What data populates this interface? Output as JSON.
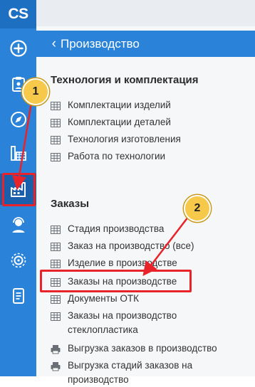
{
  "app": {
    "logo": "CS"
  },
  "rail": [
    {
      "name": "add-icon"
    },
    {
      "name": "clipboard-icon"
    },
    {
      "name": "compass-icon"
    },
    {
      "name": "warehouse-icon"
    },
    {
      "name": "factory-icon"
    },
    {
      "name": "support-agent-icon"
    },
    {
      "name": "settings-gear-icon"
    },
    {
      "name": "document-icon"
    }
  ],
  "panel": {
    "back_icon": "‹",
    "title": "Производство",
    "sections": [
      {
        "title": "Технология и комплектация",
        "items": [
          {
            "label": "Комплектации изделий",
            "icon": "table-icon"
          },
          {
            "label": "Комплектации деталей",
            "icon": "table-icon"
          },
          {
            "label": "Технология изготовления",
            "icon": "table-icon"
          },
          {
            "label": "Работа по технологии",
            "icon": "table-icon"
          }
        ]
      },
      {
        "title": "Заказы",
        "items": [
          {
            "label": "Стадия производства",
            "icon": "table-icon"
          },
          {
            "label": "Заказ на производство (все)",
            "icon": "table-icon"
          },
          {
            "label": "Изделие в производстве",
            "icon": "table-icon"
          },
          {
            "label": "Заказы на производстве",
            "icon": "table-icon"
          },
          {
            "label": "Документы ОТК",
            "icon": "table-icon"
          },
          {
            "label": "Заказы на производство стеклопластика",
            "icon": "table-icon"
          },
          {
            "label": "Выгрузка заказов в производство",
            "icon": "printer-icon"
          },
          {
            "label": "Выгрузка стадий заказов на производство",
            "icon": "printer-icon"
          }
        ]
      }
    ]
  },
  "annotations": {
    "callout_1": "1",
    "callout_2": "2",
    "color": "#e8232a"
  }
}
